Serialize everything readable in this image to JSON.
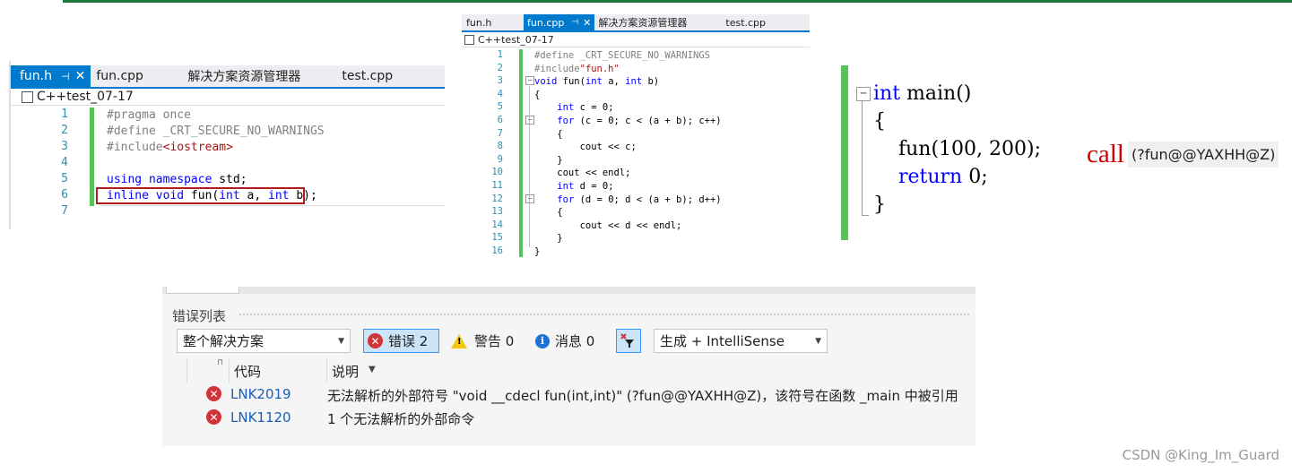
{
  "panel1": {
    "tabs": [
      {
        "label": "fun.h",
        "active": true
      },
      {
        "label": "fun.cpp",
        "active": false
      },
      {
        "label": "解决方案资源管理器",
        "active": false
      },
      {
        "label": "test.cpp",
        "active": false
      }
    ],
    "pin_glyph": "⊣",
    "close_glyph": "✕",
    "nav_label": "C++test_07-17",
    "line_numbers": [
      "1",
      "2",
      "3",
      "4",
      "5",
      "6",
      "7"
    ]
  },
  "panel2": {
    "tabs": [
      {
        "label": "fun.h",
        "active": false
      },
      {
        "label": "fun.cpp",
        "active": true
      },
      {
        "label": "解决方案资源管理器",
        "active": false
      },
      {
        "label": "test.cpp",
        "active": false
      }
    ],
    "pin_glyph": "⊣",
    "close_glyph": "✕",
    "nav_label": "C++test_07-17",
    "line_numbers": [
      "1",
      "2",
      "3",
      "4",
      "5",
      "6",
      "7",
      "8",
      "9",
      "10",
      "11",
      "12",
      "13",
      "14",
      "15",
      "16"
    ]
  },
  "panel3": {
    "call_label": "call",
    "symbol": "(?fun@@YAXHH@Z)"
  },
  "error_list": {
    "title": "错误列表",
    "scope_dropdown": "整个解决方案",
    "errors_button": "错误 2",
    "warnings_button": "警告 0",
    "messages_button": "消息 0",
    "build_dropdown": "生成 + IntelliSense",
    "columns": {
      "code": "代码",
      "description": "说明"
    },
    "rows": [
      {
        "code": "LNK2019",
        "description": "无法解析的外部符号 \"void __cdecl fun(int,int)\" (?fun@@YAXHH@Z)，该符号在函数 _main 中被引用"
      },
      {
        "code": "LNK1120",
        "description": "1 个无法解析的外部命令"
      }
    ]
  },
  "watermark": "CSDN @King_Im_Guard",
  "colors": {
    "accent": "#007acc",
    "green_change_bar": "#57c15a",
    "error_red": "#d13438",
    "link_blue": "#1a5fb4"
  }
}
